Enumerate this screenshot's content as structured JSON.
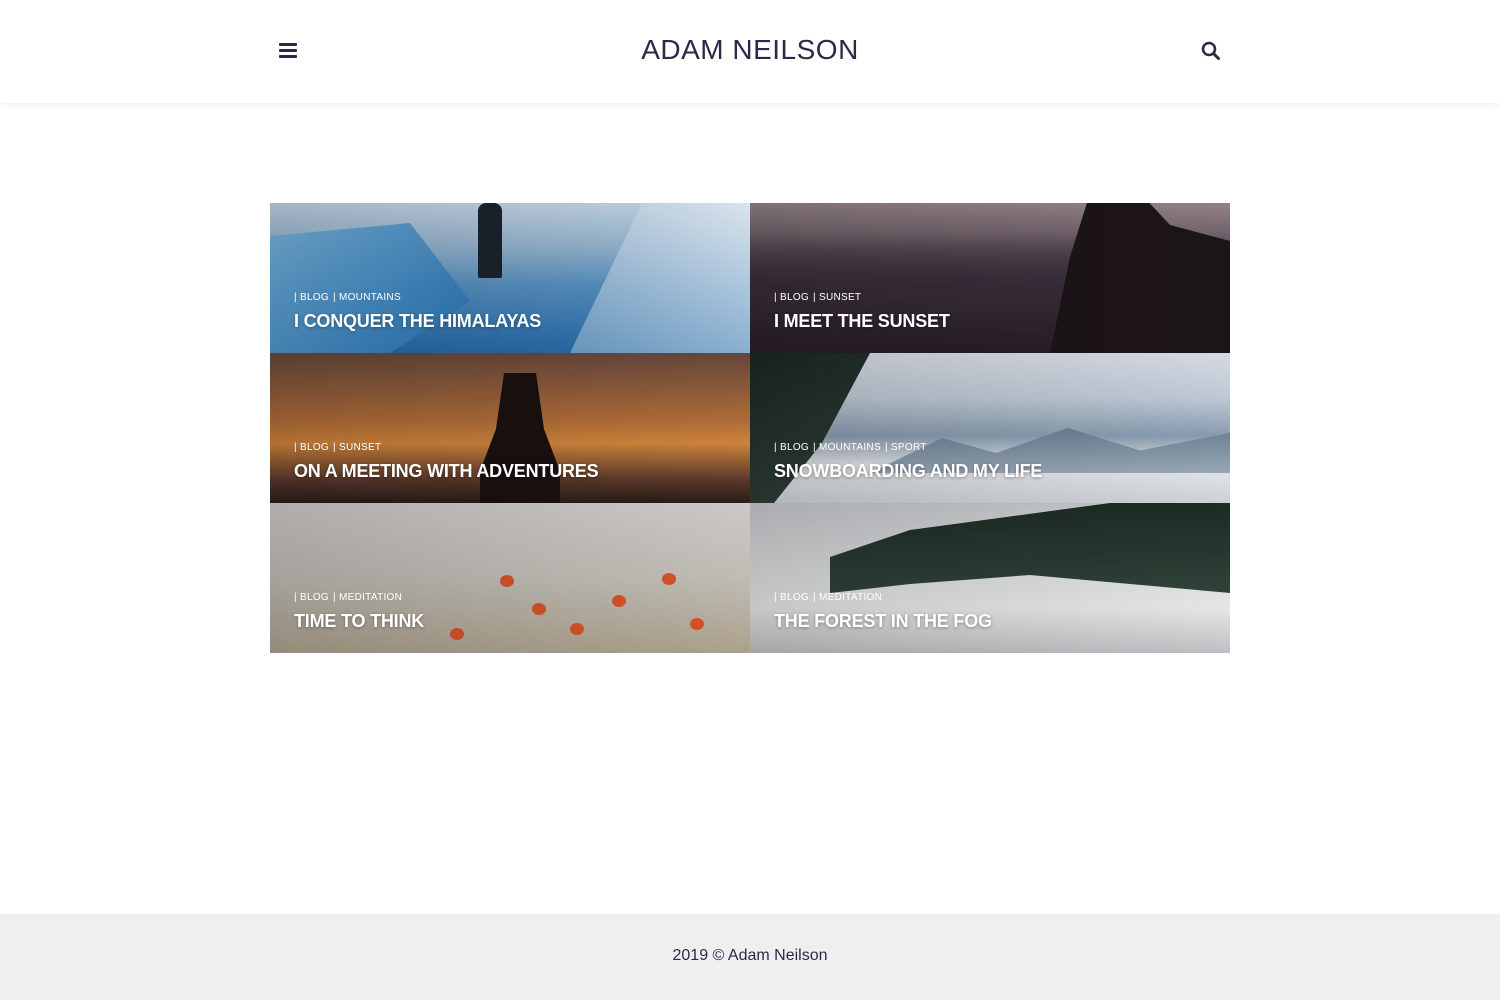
{
  "header": {
    "site_title": "ADAM NEILSON",
    "menu_icon": "menu-icon",
    "search_icon": "search-icon"
  },
  "posts": [
    {
      "categories": [
        "BLOG",
        "MOUNTAINS"
      ],
      "title": "I CONQUER THE HIMALAYAS"
    },
    {
      "categories": [
        "BLOG",
        "SUNSET"
      ],
      "title": "I MEET THE SUNSET"
    },
    {
      "categories": [
        "BLOG",
        "SUNSET"
      ],
      "title": "ON A MEETING WITH ADVENTURES"
    },
    {
      "categories": [
        "BLOG",
        "MOUNTAINS",
        "SPORT"
      ],
      "title": "SNOWBOARDING AND MY LIFE"
    },
    {
      "categories": [
        "BLOG",
        "MEDITATION"
      ],
      "title": "TIME TO THINK"
    },
    {
      "categories": [
        "BLOG",
        "MEDITATION"
      ],
      "title": "THE FOREST IN THE FOG"
    }
  ],
  "footer": {
    "copyright": "2019 © Adam Neilson"
  },
  "colors": {
    "brand_text": "#2e2848",
    "footer_bg": "#efeff0"
  }
}
